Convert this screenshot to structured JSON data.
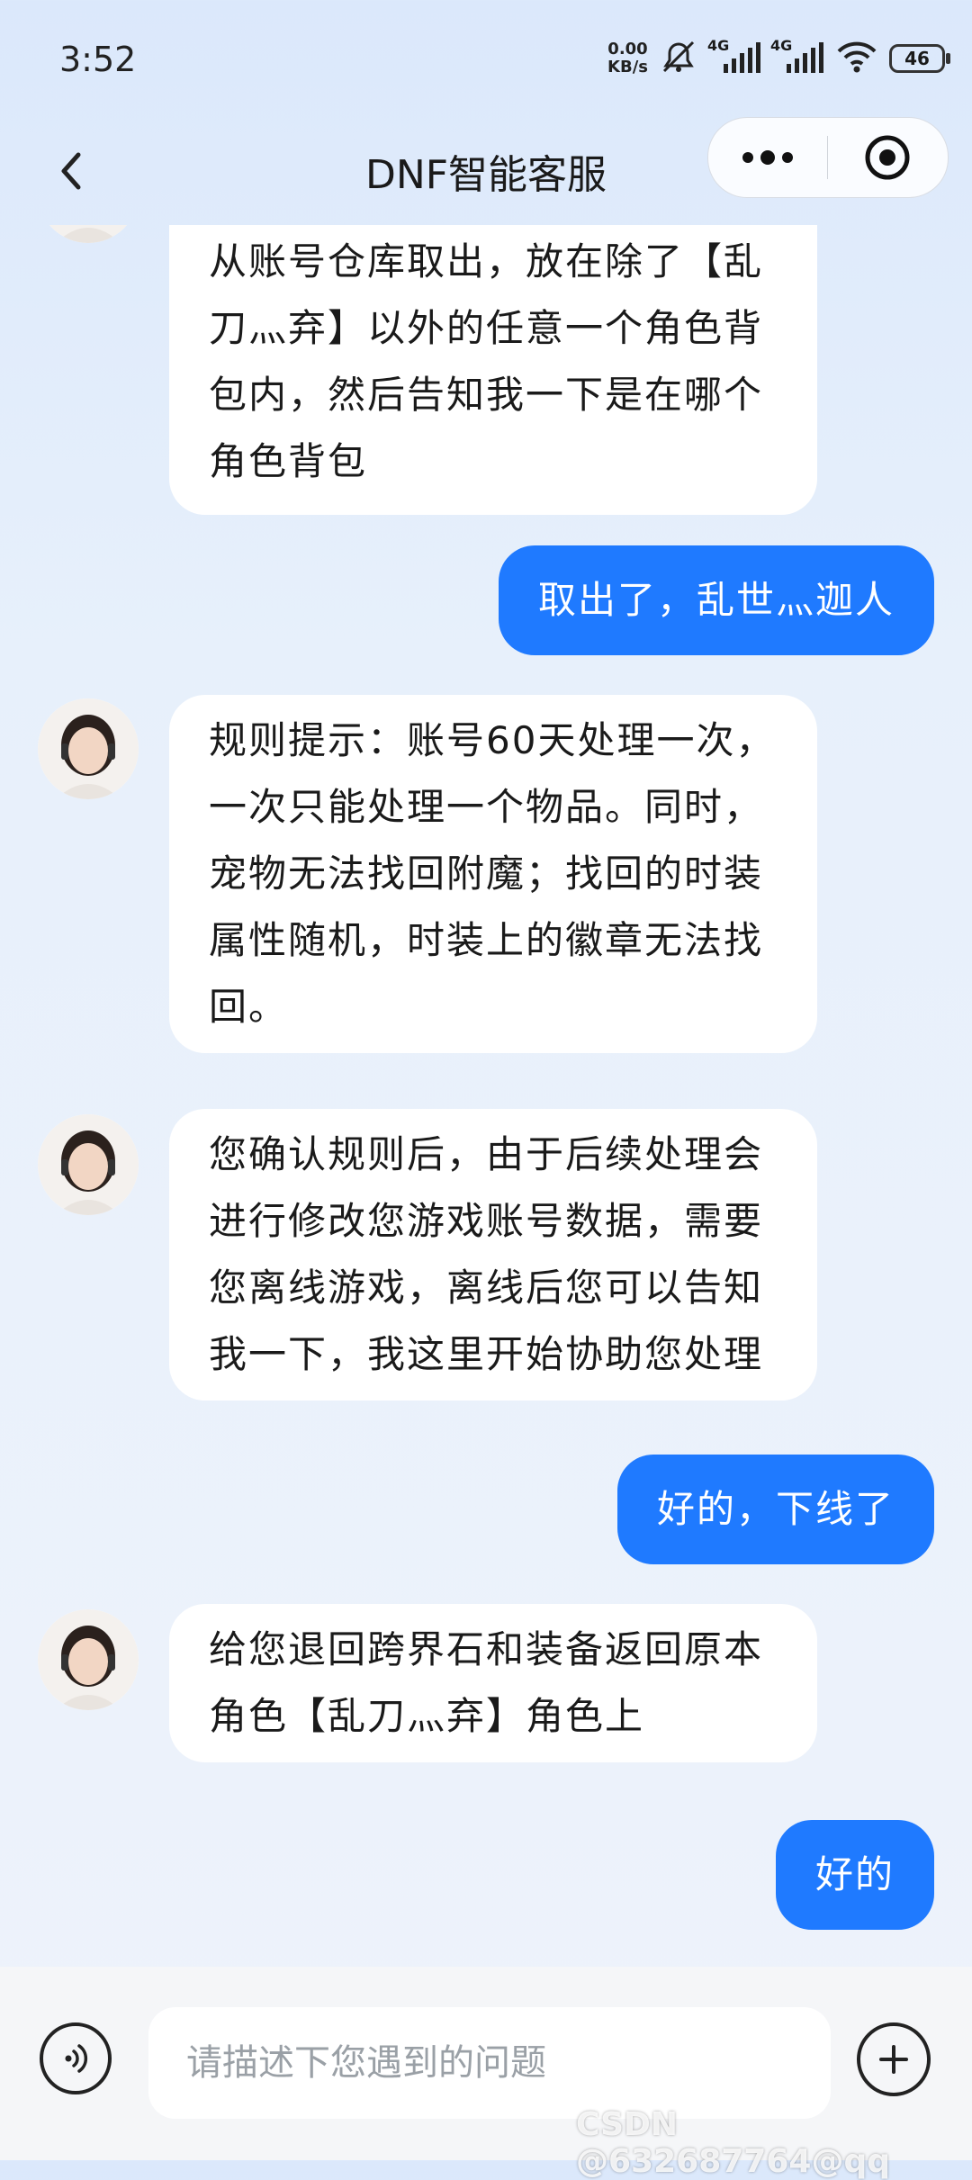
{
  "status_bar": {
    "time": "3:52",
    "net_speed_value": "0.00",
    "net_speed_unit": "KB/s",
    "signal1_label": "4G",
    "signal2_label": "4G",
    "battery": "46"
  },
  "nav": {
    "title": "DNF智能客服"
  },
  "messages": [
    {
      "role": "agent",
      "text": "从账号仓库取出，放在除了【乱刀灬弃】以外的任意一个角色背包内，然后告知我一下是在哪个角色背包"
    },
    {
      "role": "user",
      "text": "取出了，乱世灬迦人"
    },
    {
      "role": "agent",
      "text": "规则提示：账号60天处理一次，一次只能处理一个物品。同时，宠物无法找回附魔；找回的时装属性随机，时装上的徽章无法找回。"
    },
    {
      "role": "agent",
      "text": "您确认规则后，由于后续处理会进行修改您游戏账号数据，需要您离线游戏，离线后您可以告知我一下，我这里开始协助您处理"
    },
    {
      "role": "user",
      "text": "好的，下线了"
    },
    {
      "role": "agent",
      "text": "给您退回跨界石和装备返回原本角色【乱刀灬弃】角色上"
    },
    {
      "role": "user",
      "text": "好的"
    }
  ],
  "input": {
    "placeholder": "请描述下您遇到的问题"
  },
  "watermark": "CSDN @632687764@qq"
}
